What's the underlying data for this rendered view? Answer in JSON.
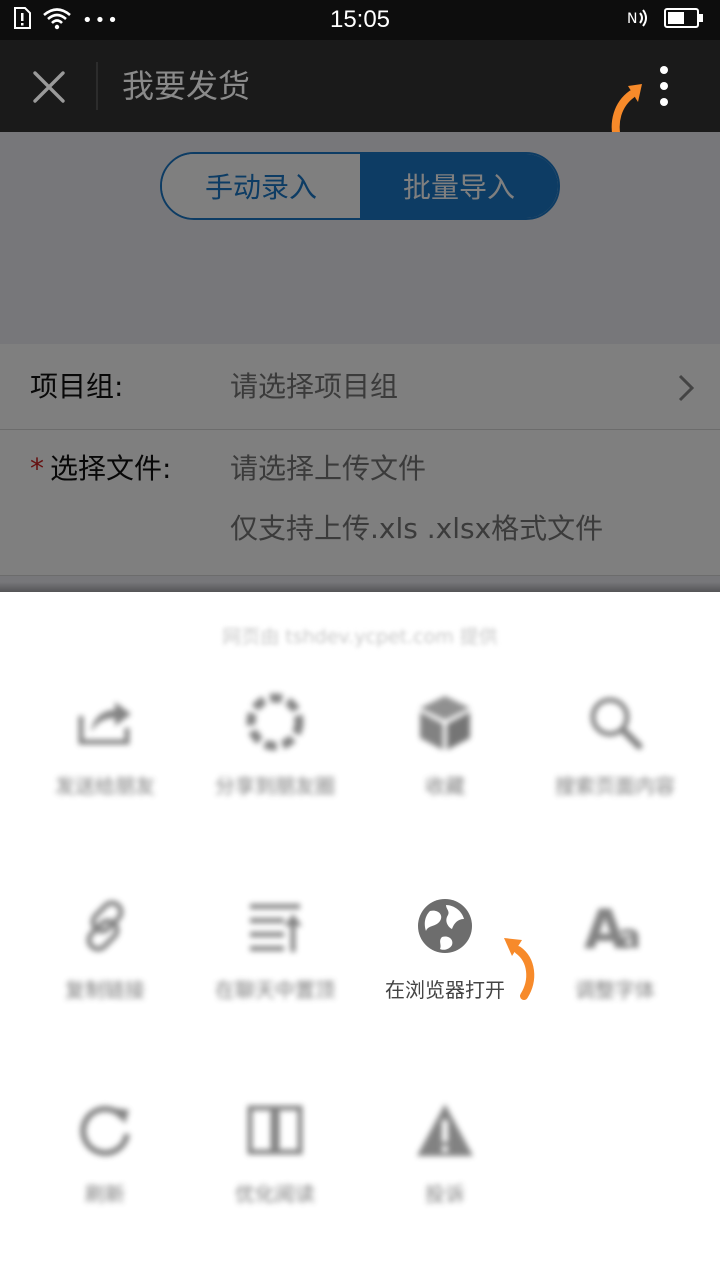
{
  "status_bar": {
    "time": "15:05",
    "overflow_dots": "•••"
  },
  "title_bar": {
    "title": "我要发货"
  },
  "segmented_control": {
    "manual_label": "手动录入",
    "batch_label": "批量导入",
    "selected": "批量导入"
  },
  "form": {
    "project_label": "项目组:",
    "project_placeholder": "请选择项目组",
    "required_mark": "*",
    "file_label": "选择文件:",
    "file_placeholder": "请选择上传文件",
    "file_hint": "仅支持上传.xls .xlsx格式文件"
  },
  "share_sheet": {
    "source_text": "网页由 tshdev.ycpet.com 提供",
    "items": [
      {
        "label": "发送给朋友",
        "icon": "share-forward-icon"
      },
      {
        "label": "分享到朋友圈",
        "icon": "moments-aperture-icon"
      },
      {
        "label": "收藏",
        "icon": "favorite-cube-icon"
      },
      {
        "label": "搜索页面内容",
        "icon": "search-icon"
      },
      {
        "label": "复制链接",
        "icon": "link-icon"
      },
      {
        "label": "在聊天中置顶",
        "icon": "pin-to-top-icon"
      },
      {
        "label": "在浏览器打开",
        "icon": "globe-icon"
      },
      {
        "label": "调整字体",
        "icon": "font-size-icon"
      },
      {
        "label": "刷新",
        "icon": "refresh-icon"
      },
      {
        "label": "优化阅读",
        "icon": "book-icon"
      },
      {
        "label": "投诉",
        "icon": "warning-icon"
      }
    ]
  },
  "colors": {
    "accent_blue": "#1a78c8",
    "annotation_orange": "#f78a2a",
    "titlebar_bg": "#1a1a1a",
    "icon_gray": "#6d6d6d"
  }
}
